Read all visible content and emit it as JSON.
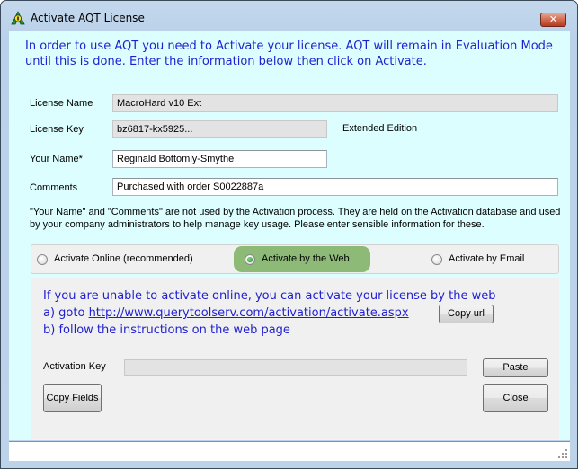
{
  "window": {
    "title": "Activate AQT License",
    "close_glyph": "✕"
  },
  "intro": {
    "text": "In order to use AQT you need to Activate your license. AQT will remain in Evaluation Mode until this is done. Enter the information below then click on Activate."
  },
  "form": {
    "license_name": {
      "label": "License Name",
      "value": "MacroHard v10 Ext"
    },
    "license_key": {
      "label": "License Key",
      "value": "bz6817-kx5925...",
      "edition": "Extended Edition"
    },
    "your_name": {
      "label": "Your Name*",
      "value": "Reginald Bottomly-Smythe"
    },
    "comments": {
      "label": "Comments",
      "value": "Purchased with order S0022887a"
    }
  },
  "note": {
    "text": "\"Your Name\" and \"Comments\" are not used by the Activation process. They are held on the Activation database and used by your company administrators to help manage key usage. Please enter sensible information for these."
  },
  "activation_modes": {
    "selected": "web",
    "options": [
      {
        "id": "online",
        "label": "Activate Online (recommended)",
        "checked": false
      },
      {
        "id": "web",
        "label": "Activate by the Web",
        "checked": true
      },
      {
        "id": "email",
        "label": "Activate by Email",
        "checked": false
      }
    ]
  },
  "web_panel": {
    "line1": "If you are unable to activate online, you can activate your license by the web",
    "line2_prefix": "a) goto ",
    "url": "http://www.querytoolserv.com/activation/activate.aspx",
    "line3": "b) follow the instructions on the web page",
    "copy_url_label": "Copy url",
    "activation_key_label": "Activation Key",
    "activation_key_value": "",
    "paste_label": "Paste",
    "copy_fields_label": "Copy Fields",
    "close_label": "Close"
  },
  "colors": {
    "client_bg": "#dcfefe",
    "info_text": "#1f1fcf",
    "selected_mode_bg": "#8dba77",
    "panel_bg": "#f0f0f0"
  }
}
